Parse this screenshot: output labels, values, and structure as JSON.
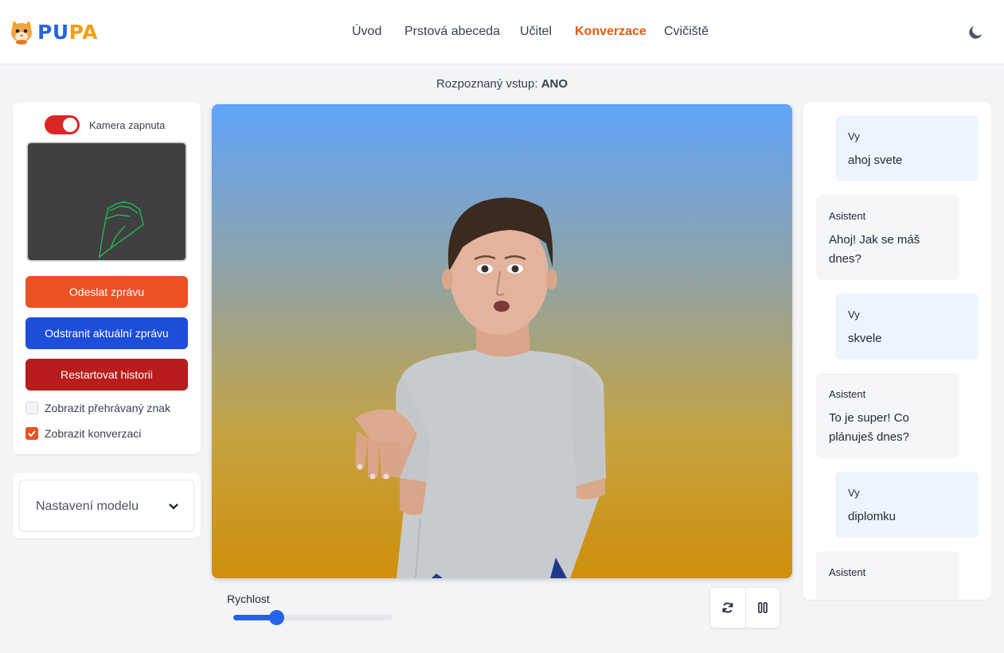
{
  "brand": {
    "name_part1": "PU",
    "name_part2": "PA"
  },
  "nav": {
    "items": [
      "Úvod",
      "Prstová abeceda",
      "Učitel",
      "Konverzace",
      "Cvičiště"
    ],
    "active": "Konverzace"
  },
  "recognized": {
    "label": "Rozpoznaný vstup:",
    "value": "ANO"
  },
  "left": {
    "camera_label": "Kamera zapnuta",
    "camera_on": true,
    "send_button": "Odeslat zprávu",
    "delete_button": "Odstranit aktuální zprávu",
    "reset_button": "Restartovat historii",
    "checkbox_sign": {
      "label": "Zobrazit přehrávaný znak",
      "checked": false
    },
    "checkbox_conv": {
      "label": "Zobrazit konverzaci",
      "checked": true
    },
    "model_settings": "Nastavení modelu"
  },
  "player": {
    "speed_label": "Rychlost",
    "speed_value": 0.27
  },
  "chat": {
    "messages": [
      {
        "role": "user",
        "who": "Vy",
        "text": "ahoj svete"
      },
      {
        "role": "bot",
        "who": "Asistent",
        "text": "Ahoj! Jak se máš dnes?"
      },
      {
        "role": "user",
        "who": "Vy",
        "text": "skvele"
      },
      {
        "role": "bot",
        "who": "Asistent",
        "text": "To je super! Co plánuješ dnes?"
      },
      {
        "role": "user",
        "who": "Vy",
        "text": "diplomku"
      },
      {
        "role": "bot",
        "who": "Asistent",
        "text": ""
      }
    ]
  },
  "colors": {
    "accent": "#ea5125",
    "primary": "#2563eb",
    "danger": "#b91c1c",
    "nav_active": "#ea580c"
  }
}
